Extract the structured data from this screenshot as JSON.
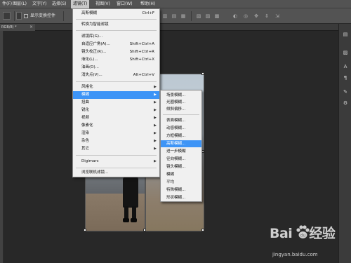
{
  "menubar": {
    "items": [
      "件(F)",
      "图层(L)",
      "文字(Y)",
      "选择(S)",
      "滤镜(T)",
      "视图(V)",
      "窗口(W)",
      "帮助(H)"
    ],
    "active_index": 4
  },
  "options": {
    "checkbox_label": "显示变换控件"
  },
  "doc_tab": {
    "label": "RGB/8) *",
    "close": "×"
  },
  "filter_menu": {
    "items": [
      {
        "label": "高斯模糊",
        "shortcut": "Ctrl+F"
      },
      {
        "label": "转换为智能滤镜",
        "shortcut": ""
      },
      {
        "label": "滤镜库(G)...",
        "shortcut": ""
      },
      {
        "label": "自适应广角(A)...",
        "shortcut": "Shift+Ctrl+A"
      },
      {
        "label": "镜头校正(R)...",
        "shortcut": "Shift+Ctrl+R"
      },
      {
        "label": "液化(L)...",
        "shortcut": "Shift+Ctrl+X"
      },
      {
        "label": "油画(O)...",
        "shortcut": ""
      },
      {
        "label": "消失点(V)...",
        "shortcut": "Alt+Ctrl+V"
      },
      {
        "label": "风格化",
        "shortcut": ""
      },
      {
        "label": "模糊",
        "shortcut": ""
      },
      {
        "label": "扭曲",
        "shortcut": ""
      },
      {
        "label": "锐化",
        "shortcut": ""
      },
      {
        "label": "视频",
        "shortcut": ""
      },
      {
        "label": "像素化",
        "shortcut": ""
      },
      {
        "label": "渲染",
        "shortcut": ""
      },
      {
        "label": "杂色",
        "shortcut": ""
      },
      {
        "label": "其它",
        "shortcut": ""
      },
      {
        "label": "Digimarc",
        "shortcut": ""
      },
      {
        "label": "浏览联机滤镜...",
        "shortcut": ""
      }
    ]
  },
  "blur_submenu": {
    "items": [
      "场景模糊...",
      "光圈模糊...",
      "倾斜偏移...",
      "表面模糊...",
      "动感模糊...",
      "方框模糊...",
      "高斯模糊...",
      "进一步模糊",
      "径向模糊...",
      "镜头模糊...",
      "模糊",
      "平均",
      "特殊模糊...",
      "形状模糊..."
    ]
  },
  "watermark": {
    "logo_left": "Bai",
    "logo_right": "经验",
    "url": "jingyan.baidu.com"
  }
}
